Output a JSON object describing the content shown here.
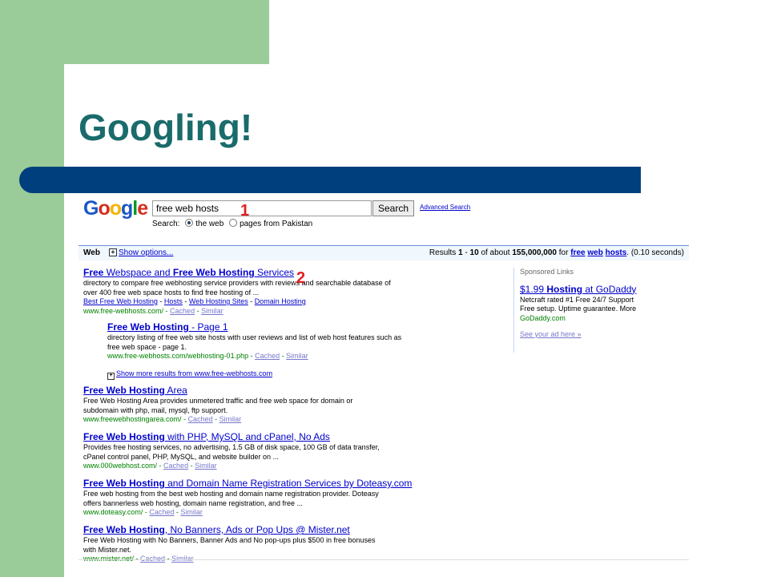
{
  "slide": {
    "title": "Googling!"
  },
  "logo": {
    "letters": [
      "G",
      "o",
      "o",
      "g",
      "l",
      "e"
    ],
    "colors": [
      "#1a57c6",
      "#d62d20",
      "#f4b400",
      "#1a57c6",
      "#009925",
      "#d62d20"
    ]
  },
  "search": {
    "query": "free web hosts",
    "button_label": "Search",
    "advanced_link": "Advanced Search",
    "options_label": "Search:",
    "option_web": "the web",
    "option_country": "pages from Pakistan",
    "marker_1": "1",
    "marker_2": "2"
  },
  "webbar": {
    "label": "Web",
    "show_options": "Show options...",
    "results_prefix": "Results",
    "range_start": "1",
    "range_sep": "-",
    "range_end": "10",
    "of_about": "of about",
    "total": "155,000,000",
    "for_word": "for",
    "q1": "free",
    "q2": "web",
    "q3": "hosts",
    "time": "(0.10 seconds)"
  },
  "results": [
    {
      "title_parts": [
        "Free",
        " Webspace and ",
        "Free Web Hosting",
        " Services"
      ],
      "snippet_lines": [
        "directory to compare free webhosting service providers with reviews and searchable database of",
        "over 400 free web space hosts to find free hosting of ..."
      ],
      "sublinks": [
        "Best Free Web Hosting",
        "Hosts",
        "Web Hosting Sites",
        "Domain Hosting"
      ],
      "url": "www.free-webhosts.com/",
      "cached": "Cached",
      "similar": "Similar"
    },
    {
      "title_parts": [
        "Free Web Hosting",
        " - Page 1"
      ],
      "snippet_lines": [
        "directory listing of free web site hosts with user reviews and list of web host features such as",
        "free web space - page 1."
      ],
      "url": "www.free-webhosts.com/webhosting-01.php",
      "cached": "Cached",
      "similar": "Similar"
    },
    {
      "title_parts": [
        "Free Web Hosting",
        " Area"
      ],
      "snippet_lines": [
        "Free Web Hosting Area provides unmetered traffic and free web space for domain or",
        "subdomain with php, mail, mysql, ftp support."
      ],
      "url": "www.freewebhostingarea.com/",
      "cached": "Cached",
      "similar": "Similar"
    },
    {
      "title_parts": [
        "Free Web Hosting",
        " with PHP, MySQL and cPanel, No Ads"
      ],
      "snippet_lines": [
        "Provides free hosting services, no advertising, 1.5 GB of disk space, 100 GB of data transfer,",
        "cPanel control panel, PHP, MySQL, and website builder on ..."
      ],
      "url": "www.000webhost.com/",
      "cached": "Cached",
      "similar": "Similar"
    },
    {
      "title_parts": [
        "Free Web Hosting",
        " and Domain Name Registration Services by Doteasy.com"
      ],
      "snippet_lines": [
        "Free web hosting from the best web hosting and domain name registration provider. Doteasy",
        "offers bannerless web hosting, domain name registration, and free ..."
      ],
      "url": "www.doteasy.com/",
      "cached": "Cached",
      "similar": "Similar"
    },
    {
      "title_parts": [
        "Free Web Hosting",
        ", No Banners, Ads or Pop Ups @ Mister.net"
      ],
      "snippet_lines": [
        "Free Web Hosting with No Banners, Banner Ads and No pop-ups plus $500 in free bonuses",
        "with Mister.net."
      ],
      "url": "www.mister.net/",
      "cached": "Cached",
      "similar": "Similar"
    }
  ],
  "more_results": "Show more results from www.free-webhosts.com",
  "sponsored": {
    "header": "Sponsored Links",
    "ad_title_a": "$1.99 ",
    "ad_title_b": "Hosting",
    "ad_title_c": " at GoDaddy",
    "ad_line1": "Netcraft rated #1 Free 24/7 Support",
    "ad_line2": "Free setup. Uptime guarantee. More",
    "ad_url": "GoDaddy.com",
    "see_ad": "See your ad here »"
  },
  "colors": {
    "green": "#99cc99",
    "title": "#1a6b6b",
    "blue_bar": "#003f7d",
    "link": "#0000cc",
    "url_green": "#008000",
    "marker_red": "#e02020"
  }
}
